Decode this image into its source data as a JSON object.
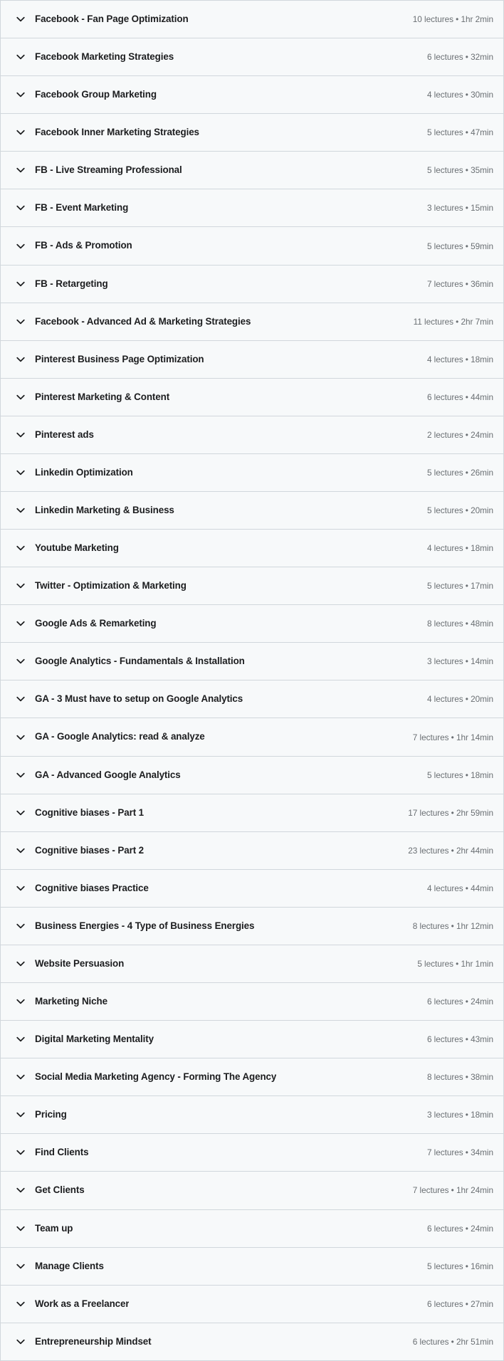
{
  "accordion": {
    "icon": "chevron-down-icon",
    "colors": {
      "row_background": "#f7f9fa",
      "border": "#d1d7dc",
      "title_text": "#1c1d1f",
      "meta_text": "#6a6f73"
    },
    "sections": [
      {
        "title": "Facebook - Fan Page Optimization",
        "meta": "10 lectures • 1hr 2min",
        "lectures": 10,
        "duration": "1hr 2min"
      },
      {
        "title": "Facebook Marketing Strategies",
        "meta": "6 lectures • 32min",
        "lectures": 6,
        "duration": "32min"
      },
      {
        "title": "Facebook Group Marketing",
        "meta": "4 lectures • 30min",
        "lectures": 4,
        "duration": "30min"
      },
      {
        "title": "Facebook Inner Marketing Strategies",
        "meta": "5 lectures • 47min",
        "lectures": 5,
        "duration": "47min"
      },
      {
        "title": "FB - Live Streaming Professional",
        "meta": "5 lectures • 35min",
        "lectures": 5,
        "duration": "35min"
      },
      {
        "title": "FB - Event Marketing",
        "meta": "3 lectures • 15min",
        "lectures": 3,
        "duration": "15min"
      },
      {
        "title": "FB - Ads & Promotion",
        "meta": "5 lectures • 59min",
        "lectures": 5,
        "duration": "59min"
      },
      {
        "title": "FB - Retargeting",
        "meta": "7 lectures • 36min",
        "lectures": 7,
        "duration": "36min"
      },
      {
        "title": "Facebook - Advanced Ad & Marketing Strategies",
        "meta": "11 lectures • 2hr 7min",
        "lectures": 11,
        "duration": "2hr 7min"
      },
      {
        "title": "Pinterest Business Page Optimization",
        "meta": "4 lectures • 18min",
        "lectures": 4,
        "duration": "18min"
      },
      {
        "title": "Pinterest Marketing & Content",
        "meta": "6 lectures • 44min",
        "lectures": 6,
        "duration": "44min"
      },
      {
        "title": "Pinterest ads",
        "meta": "2 lectures • 24min",
        "lectures": 2,
        "duration": "24min"
      },
      {
        "title": "Linkedin Optimization",
        "meta": "5 lectures • 26min",
        "lectures": 5,
        "duration": "26min"
      },
      {
        "title": "Linkedin Marketing & Business",
        "meta": "5 lectures • 20min",
        "lectures": 5,
        "duration": "20min"
      },
      {
        "title": "Youtube Marketing",
        "meta": "4 lectures • 18min",
        "lectures": 4,
        "duration": "18min"
      },
      {
        "title": "Twitter - Optimization & Marketing",
        "meta": "5 lectures • 17min",
        "lectures": 5,
        "duration": "17min"
      },
      {
        "title": "Google Ads & Remarketing",
        "meta": "8 lectures • 48min",
        "lectures": 8,
        "duration": "48min"
      },
      {
        "title": "Google Analytics - Fundamentals & Installation",
        "meta": "3 lectures • 14min",
        "lectures": 3,
        "duration": "14min"
      },
      {
        "title": "GA - 3 Must have to setup on Google Analytics",
        "meta": "4 lectures • 20min",
        "lectures": 4,
        "duration": "20min"
      },
      {
        "title": "GA - Google Analytics: read & analyze",
        "meta": "7 lectures • 1hr 14min",
        "lectures": 7,
        "duration": "1hr 14min"
      },
      {
        "title": "GA - Advanced Google Analytics",
        "meta": "5 lectures • 18min",
        "lectures": 5,
        "duration": "18min"
      },
      {
        "title": "Cognitive biases - Part 1",
        "meta": "17 lectures • 2hr 59min",
        "lectures": 17,
        "duration": "2hr 59min"
      },
      {
        "title": "Cognitive biases - Part 2",
        "meta": "23 lectures • 2hr 44min",
        "lectures": 23,
        "duration": "2hr 44min"
      },
      {
        "title": "Cognitive biases Practice",
        "meta": "4 lectures • 44min",
        "lectures": 4,
        "duration": "44min"
      },
      {
        "title": "Business Energies - 4 Type of Business Energies",
        "meta": "8 lectures • 1hr 12min",
        "lectures": 8,
        "duration": "1hr 12min"
      },
      {
        "title": "Website Persuasion",
        "meta": "5 lectures • 1hr 1min",
        "lectures": 5,
        "duration": "1hr 1min"
      },
      {
        "title": "Marketing Niche",
        "meta": "6 lectures • 24min",
        "lectures": 6,
        "duration": "24min"
      },
      {
        "title": "Digital Marketing Mentality",
        "meta": "6 lectures • 43min",
        "lectures": 6,
        "duration": "43min"
      },
      {
        "title": "Social Media Marketing Agency - Forming The Agency",
        "meta": "8 lectures • 38min",
        "lectures": 8,
        "duration": "38min"
      },
      {
        "title": "Pricing",
        "meta": "3 lectures • 18min",
        "lectures": 3,
        "duration": "18min"
      },
      {
        "title": "Find Clients",
        "meta": "7 lectures • 34min",
        "lectures": 7,
        "duration": "34min"
      },
      {
        "title": "Get Clients",
        "meta": "7 lectures • 1hr 24min",
        "lectures": 7,
        "duration": "1hr 24min"
      },
      {
        "title": "Team up",
        "meta": "6 lectures • 24min",
        "lectures": 6,
        "duration": "24min"
      },
      {
        "title": "Manage Clients",
        "meta": "5 lectures • 16min",
        "lectures": 5,
        "duration": "16min"
      },
      {
        "title": "Work as a Freelancer",
        "meta": "6 lectures • 27min",
        "lectures": 6,
        "duration": "27min"
      },
      {
        "title": "Entrepreneurship Mindset",
        "meta": "6 lectures • 2hr 51min",
        "lectures": 6,
        "duration": "2hr 51min"
      }
    ]
  }
}
